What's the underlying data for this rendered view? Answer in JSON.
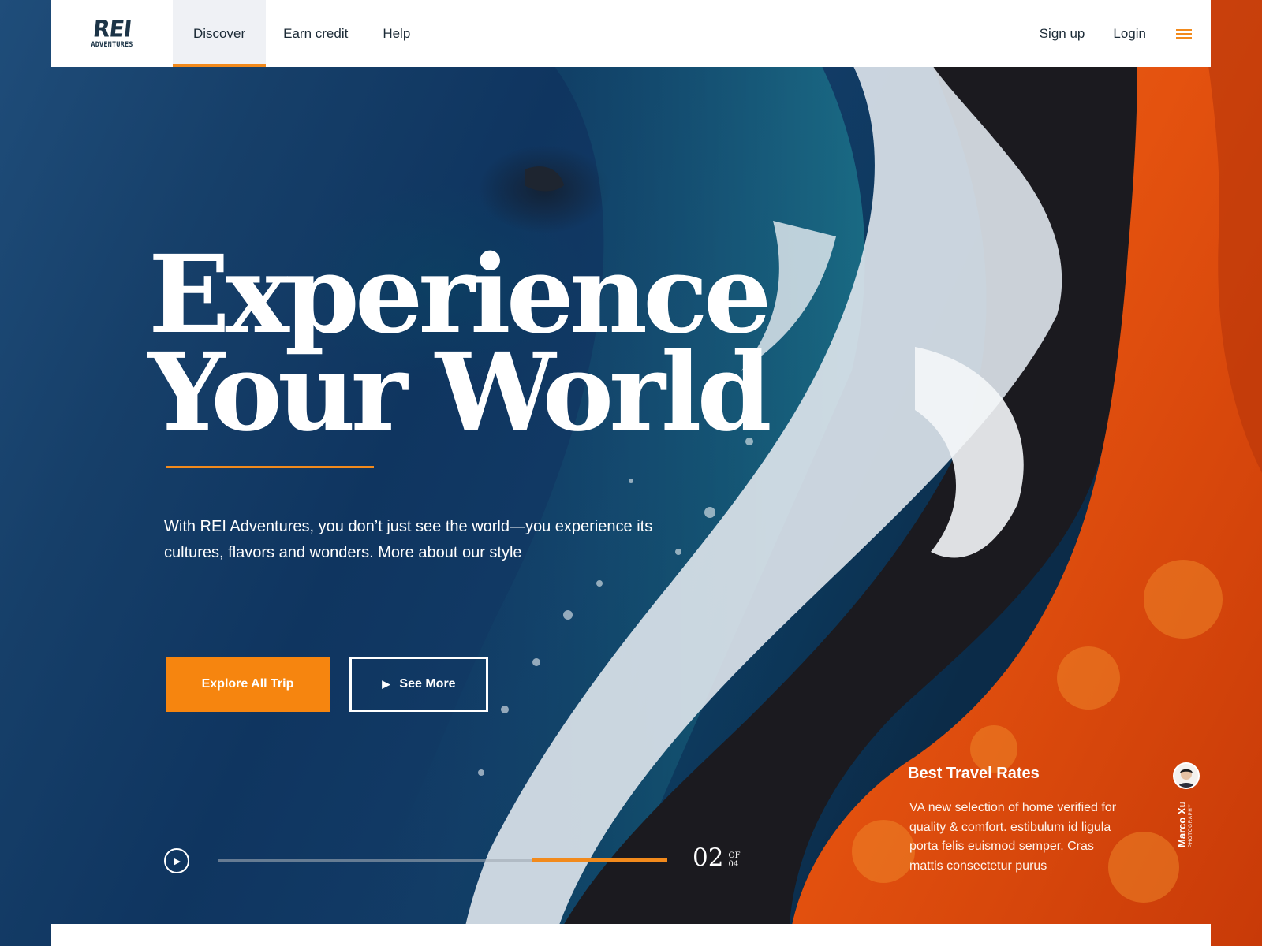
{
  "brand": {
    "logo_mark": "REI",
    "logo_sub": "ADVENTURES"
  },
  "nav": {
    "items": [
      {
        "label": "Discover",
        "active": true
      },
      {
        "label": "Earn credit",
        "active": false
      },
      {
        "label": "Help",
        "active": false
      }
    ],
    "signup": "Sign up",
    "login": "Login",
    "menu_icon": "hamburger-menu-icon"
  },
  "hero": {
    "headline_line1": "Experience",
    "headline_line2": "Your World",
    "intro": "With REI Adventures, you don’t just see the world—you experience its cultures, flavors and wonders. More about our style",
    "primary_cta": "Explore All Trip",
    "secondary_cta": "See More",
    "secondary_cta_icon": "play-triangle-icon"
  },
  "slider": {
    "current": "02",
    "of_label": "OF",
    "total": "04",
    "progress_fraction": 0.3,
    "progress_start_fraction": 0.7,
    "play_icon": "play-circle-icon"
  },
  "card": {
    "title": "Best Travel Rates",
    "text": "VA new selection of home verified for quality & comfort. estibulum id ligula porta felis euismod semper. Cras mattis consectetur purus"
  },
  "photographer": {
    "name": "Marco Xu",
    "role": "PHOTOGRAPHY"
  },
  "colors": {
    "accent": "#f28a1c",
    "cta": "#f6850f",
    "nav_text": "#1b2a36",
    "logo": "#1c3447",
    "nav_active_bg": "#eff1f5"
  }
}
